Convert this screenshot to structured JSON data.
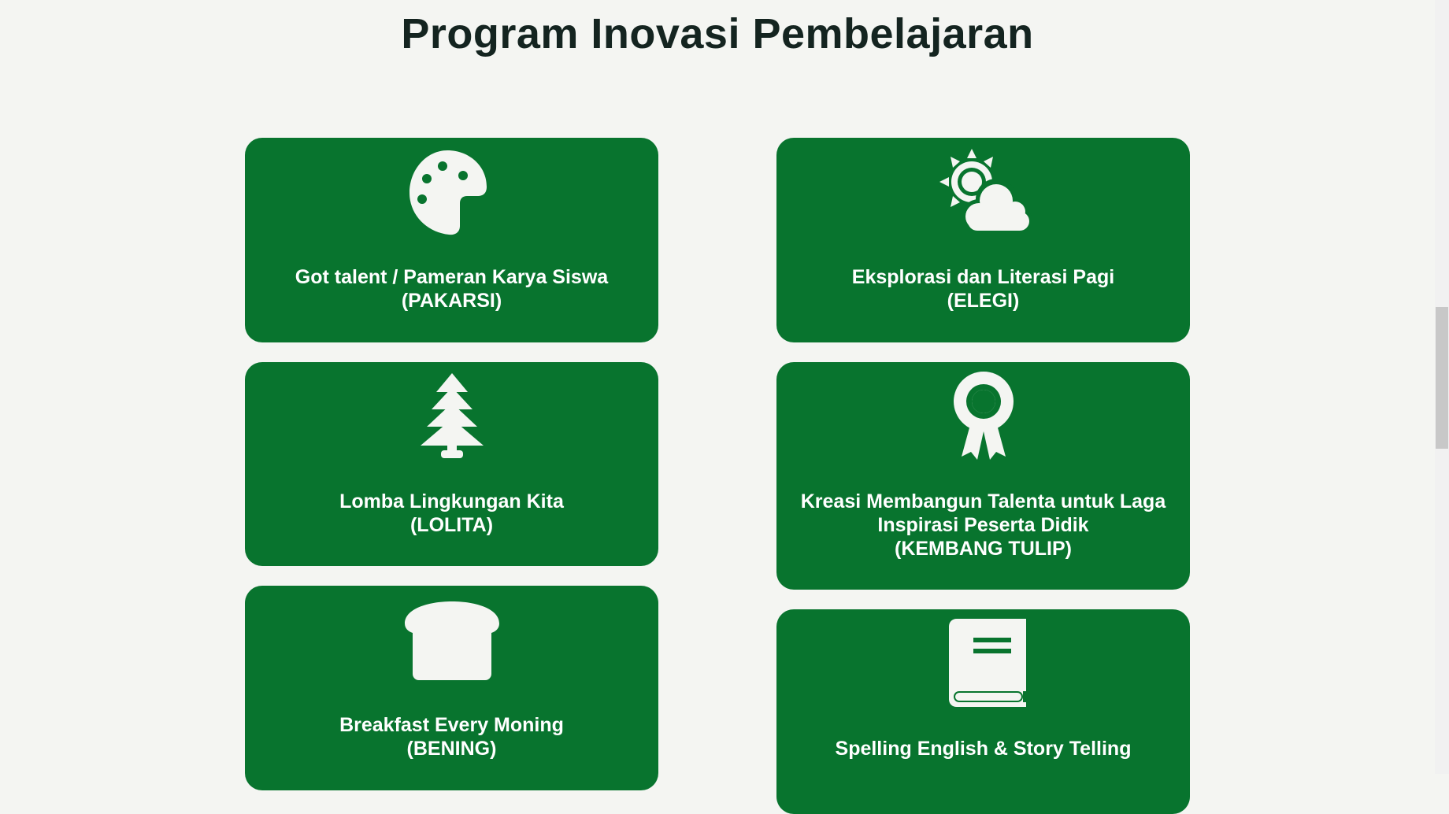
{
  "section": {
    "title": "Program Inovasi Pembelajaran"
  },
  "colors": {
    "card_bg": "#08742e",
    "page_bg": "#f4f5f2",
    "title_text": "#142420",
    "card_text": "#ffffff"
  },
  "programs": [
    {
      "icon": "palette-icon",
      "name": "Got talent / Pameran Karya Siswa",
      "lines": [],
      "acronym": "(PAKARSI)"
    },
    {
      "icon": "sun-cloud-icon",
      "name": "Eksplorasi dan Literasi Pagi",
      "lines": [],
      "acronym": "(ELEGI)"
    },
    {
      "icon": "tree-icon",
      "name": "Lomba Lingkungan Kita",
      "lines": [],
      "acronym": "(LOLITA)"
    },
    {
      "icon": "award-icon",
      "name": "",
      "lines": [
        "Kreasi Membangun Talenta untuk Laga",
        "Inspirasi Peserta Didik"
      ],
      "acronym": "(KEMBANG TULIP)"
    },
    {
      "icon": "bread-icon",
      "name": "Breakfast Every Moning",
      "lines": [],
      "acronym": "(BENING)"
    },
    {
      "icon": "book-icon",
      "name": "Spelling English & Story Telling",
      "lines": [],
      "acronym": ""
    }
  ]
}
